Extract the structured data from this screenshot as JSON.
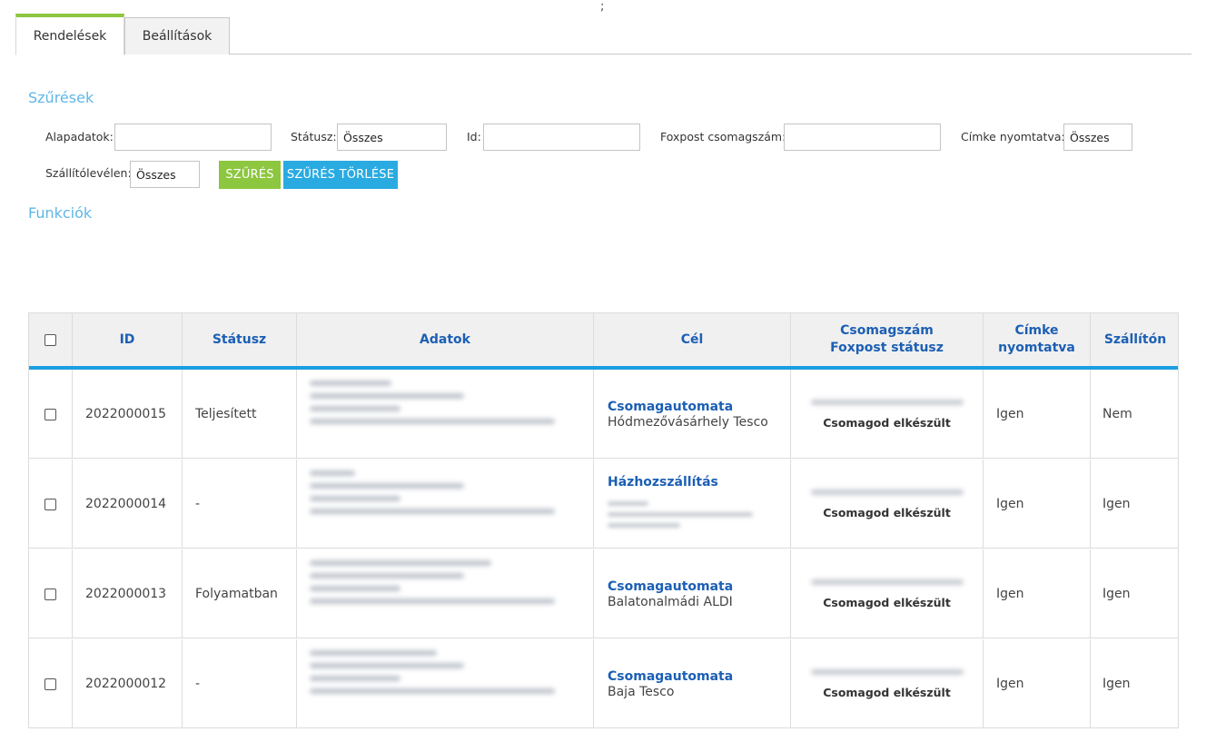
{
  "stray_char": ";",
  "tabs": [
    {
      "label": "Rendelések",
      "active": true
    },
    {
      "label": "Beállítások",
      "active": false
    }
  ],
  "filters": {
    "title": "Szűrések",
    "alapadatok": {
      "label": "Alapadatok:",
      "value": ""
    },
    "statusz": {
      "label": "Státusz:",
      "value": "Összes"
    },
    "id": {
      "label": "Id:",
      "value": ""
    },
    "foxpost": {
      "label": "Foxpost csomagszám:",
      "value": ""
    },
    "cimke": {
      "label": "Címke nyomtatva:",
      "value": "Összes"
    },
    "szallito": {
      "label": "Szállítólevélen:",
      "value": "Összes"
    },
    "btn_filter": "SZŰRÉS",
    "btn_clear": "SZŰRÉS TÖRLÉSE"
  },
  "functions": {
    "title": "Funkciók"
  },
  "table": {
    "headers": {
      "id": "ID",
      "status": "Státusz",
      "data": "Adatok",
      "target": "Cél",
      "pkg_line1": "Csomagszám",
      "pkg_line2": "Foxpost státusz",
      "label_line1": "Címke",
      "label_line2": "nyomtatva",
      "shipped": "Szállítón"
    },
    "rows": [
      {
        "id": "2022000015",
        "status": "Teljesített",
        "target_type": "Csomagautomata",
        "target_loc": "Hódmezővásárhely Tesco",
        "pkg_status": "Csomagod elkészült",
        "label_printed": "Igen",
        "shipped": "Nem"
      },
      {
        "id": "2022000014",
        "status": "-",
        "target_type": "Házhozszállítás",
        "target_loc": "",
        "pkg_status": "Csomagod elkészült",
        "label_printed": "Igen",
        "shipped": "Igen"
      },
      {
        "id": "2022000013",
        "status": "Folyamatban",
        "target_type": "Csomagautomata",
        "target_loc": "Balatonalmádi ALDI",
        "pkg_status": "Csomagod elkészült",
        "label_printed": "Igen",
        "shipped": "Igen"
      },
      {
        "id": "2022000012",
        "status": "-",
        "target_type": "Csomagautomata",
        "target_loc": "Baja Tesco",
        "pkg_status": "Csomagod elkészült",
        "label_printed": "Igen",
        "shipped": "Igen"
      }
    ]
  },
  "colors": {
    "accent_green": "#8dc63f",
    "accent_blue": "#29abe2",
    "header_text": "#1c5fb4",
    "section_title": "#5fb7e5"
  }
}
